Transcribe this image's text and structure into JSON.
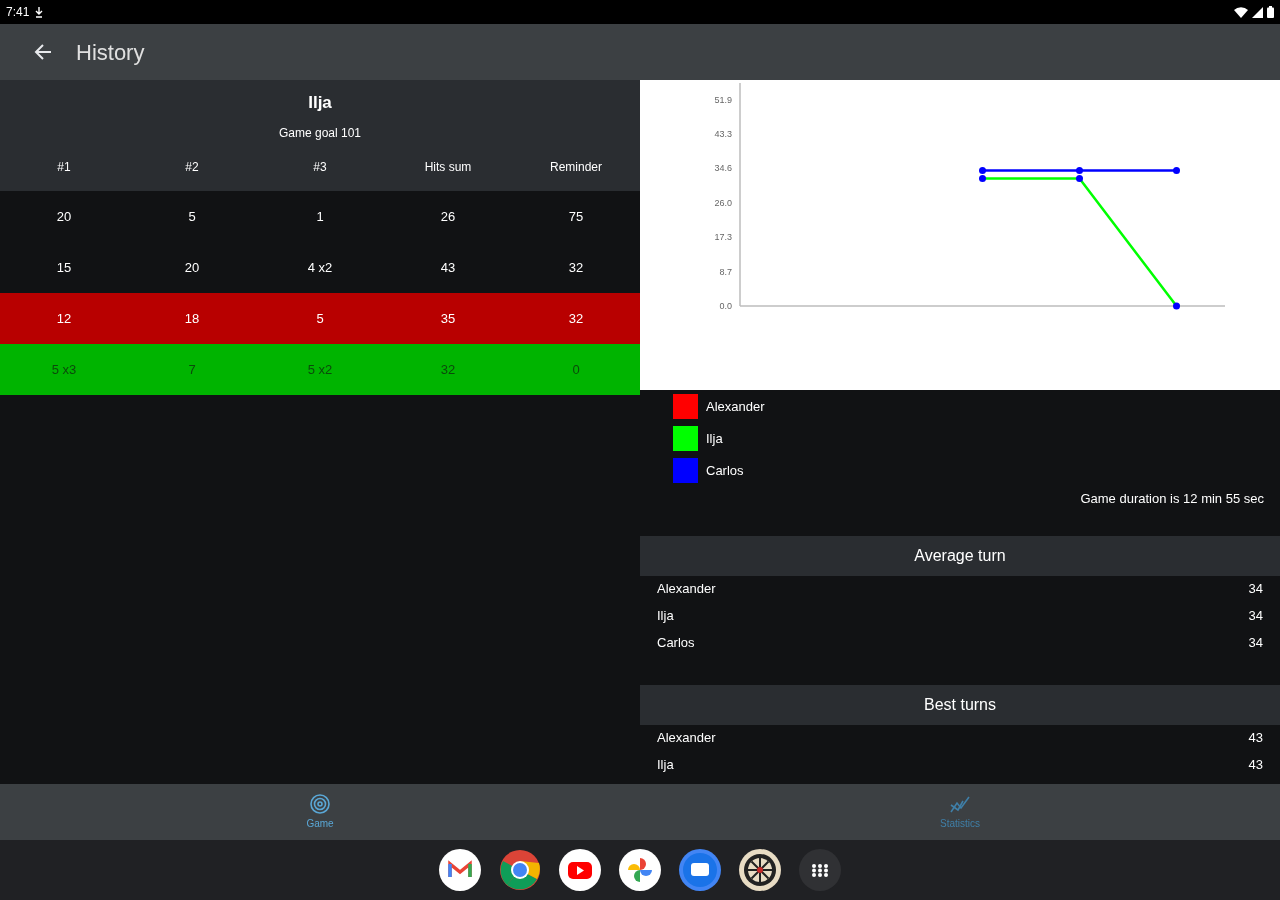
{
  "status_bar": {
    "time": "7:41"
  },
  "app_bar": {
    "title": "History"
  },
  "scoreboard": {
    "player": "Ilja",
    "goal": "Game goal 101",
    "columns": [
      "#1",
      "#2",
      "#3",
      "Hits sum",
      "Reminder"
    ],
    "rows": [
      {
        "kind": "normal",
        "cells": [
          "20",
          "5",
          "1",
          "26",
          "75"
        ]
      },
      {
        "kind": "normal",
        "cells": [
          "15",
          "20",
          "4 x2",
          "43",
          "32"
        ]
      },
      {
        "kind": "bust",
        "cells": [
          "12",
          "18",
          "5",
          "35",
          "32"
        ]
      },
      {
        "kind": "win",
        "cells": [
          "5 x3",
          "7",
          "5 x2",
          "32",
          "0"
        ]
      }
    ]
  },
  "progress_chart": {
    "chart_data": {
      "type": "line",
      "categories": [
        null,
        null,
        null,
        null,
        null
      ],
      "ylim": [
        0,
        56
      ],
      "yticks": [
        {
          "value": 0,
          "label": "0.0"
        },
        {
          "value": 8.7,
          "label": "8.7"
        },
        {
          "value": 17.3,
          "label": "17.3"
        },
        {
          "value": 26,
          "label": "26.0"
        },
        {
          "value": 34.6,
          "label": "34.6"
        },
        {
          "value": 43.3,
          "label": "43.3"
        },
        {
          "value": 51.9,
          "label": "51.9"
        }
      ],
      "series": [
        {
          "name": "Alexander",
          "color": "#ff0000",
          "values": [
            null,
            null,
            null,
            null,
            null
          ]
        },
        {
          "name": "Ilja",
          "color": "#00ff00",
          "marker": "circle",
          "values": [
            null,
            null,
            32,
            32,
            0
          ]
        },
        {
          "name": "Carlos",
          "color": "#0000ff",
          "marker": "circle",
          "values": [
            null,
            null,
            34,
            34,
            34
          ]
        }
      ]
    }
  },
  "duration": "Game duration is 12 min 55 sec",
  "sections": [
    {
      "title": "Average turn",
      "rows": [
        {
          "name": "Alexander",
          "value": "34"
        },
        {
          "name": "Ilja",
          "value": "34"
        },
        {
          "name": "Carlos",
          "value": "34"
        }
      ]
    },
    {
      "title": "Best turns",
      "rows": [
        {
          "name": "Alexander",
          "value": "43"
        },
        {
          "name": "Ilja",
          "value": "43"
        }
      ]
    }
  ],
  "bottom_nav": [
    {
      "label": "Game",
      "selected": true
    },
    {
      "label": "Statistics",
      "selected": false
    }
  ]
}
